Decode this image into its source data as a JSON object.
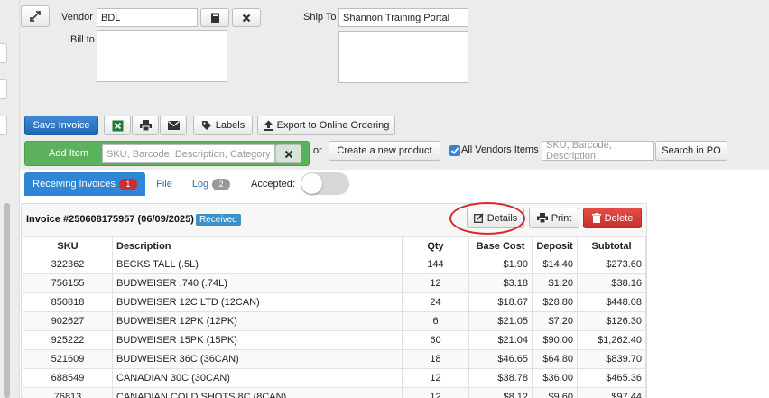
{
  "vendor": {
    "label": "Vendor",
    "value": "BDL"
  },
  "ship_to": {
    "label": "Ship To",
    "value": "Shannon Training Portal"
  },
  "bill_to": {
    "label": "Bill to",
    "value": ""
  },
  "toolbar": {
    "save_invoice": "Save Invoice",
    "labels": "Labels",
    "export": "Export to Online Ordering"
  },
  "add_item": {
    "label": "Add Item",
    "placeholder": "SKU, Barcode, Description, Category",
    "or_text": "or",
    "create_product": "Create a new product",
    "all_vendors_label": "All Vendors Items",
    "all_vendors_checked": true,
    "search_po_placeholder": "SKU, Barcode, Description",
    "search_po_button": "Search in PO"
  },
  "tabs": [
    {
      "label": "Receiving Invoices",
      "count": "1",
      "active": true
    },
    {
      "label": "File",
      "count": "",
      "active": false
    },
    {
      "label": "Log",
      "count": "2",
      "active": false
    }
  ],
  "accepted": {
    "label": "Accepted:",
    "on": false
  },
  "invoice": {
    "title": "Invoice #250608175957 (06/09/2025)",
    "status": "Received",
    "actions": {
      "details": "Details",
      "print": "Print",
      "delete": "Delete"
    }
  },
  "columns": [
    "SKU",
    "Description",
    "Qty",
    "Base Cost",
    "Deposit",
    "Subtotal"
  ],
  "rows": [
    {
      "sku": "322362",
      "description": "BECKS TALL (.5L)",
      "qty": "144",
      "base_cost": "$1.90",
      "deposit": "$14.40",
      "subtotal": "$273.60"
    },
    {
      "sku": "756155",
      "description": "BUDWEISER .740 (.74L)",
      "qty": "12",
      "base_cost": "$3.18",
      "deposit": "$1.20",
      "subtotal": "$38.16"
    },
    {
      "sku": "850818",
      "description": "BUDWEISER 12C LTD (12CAN)",
      "qty": "24",
      "base_cost": "$18.67",
      "deposit": "$28.80",
      "subtotal": "$448.08"
    },
    {
      "sku": "902627",
      "description": "BUDWEISER 12PK (12PK)",
      "qty": "6",
      "base_cost": "$21.05",
      "deposit": "$7.20",
      "subtotal": "$126.30"
    },
    {
      "sku": "925222",
      "description": "BUDWEISER 15PK (15PK)",
      "qty": "60",
      "base_cost": "$21.04",
      "deposit": "$90.00",
      "subtotal": "$1,262.40"
    },
    {
      "sku": "521609",
      "description": "BUDWEISER 36C (36CAN)",
      "qty": "18",
      "base_cost": "$46.65",
      "deposit": "$64.80",
      "subtotal": "$839.70"
    },
    {
      "sku": "688549",
      "description": "CANADIAN 30C (30CAN)",
      "qty": "12",
      "base_cost": "$38.78",
      "deposit": "$36.00",
      "subtotal": "$465.36"
    },
    {
      "sku": "76813",
      "description": "CANADIAN COLD SHOTS 8C (8CAN)",
      "qty": "12",
      "base_cost": "$8.12",
      "deposit": "$9.60",
      "subtotal": "$97.44"
    }
  ],
  "colors": {
    "primary": "#2f86d4",
    "success": "#5cb25c",
    "danger": "#c9302c",
    "badge": "#3b92c8"
  }
}
